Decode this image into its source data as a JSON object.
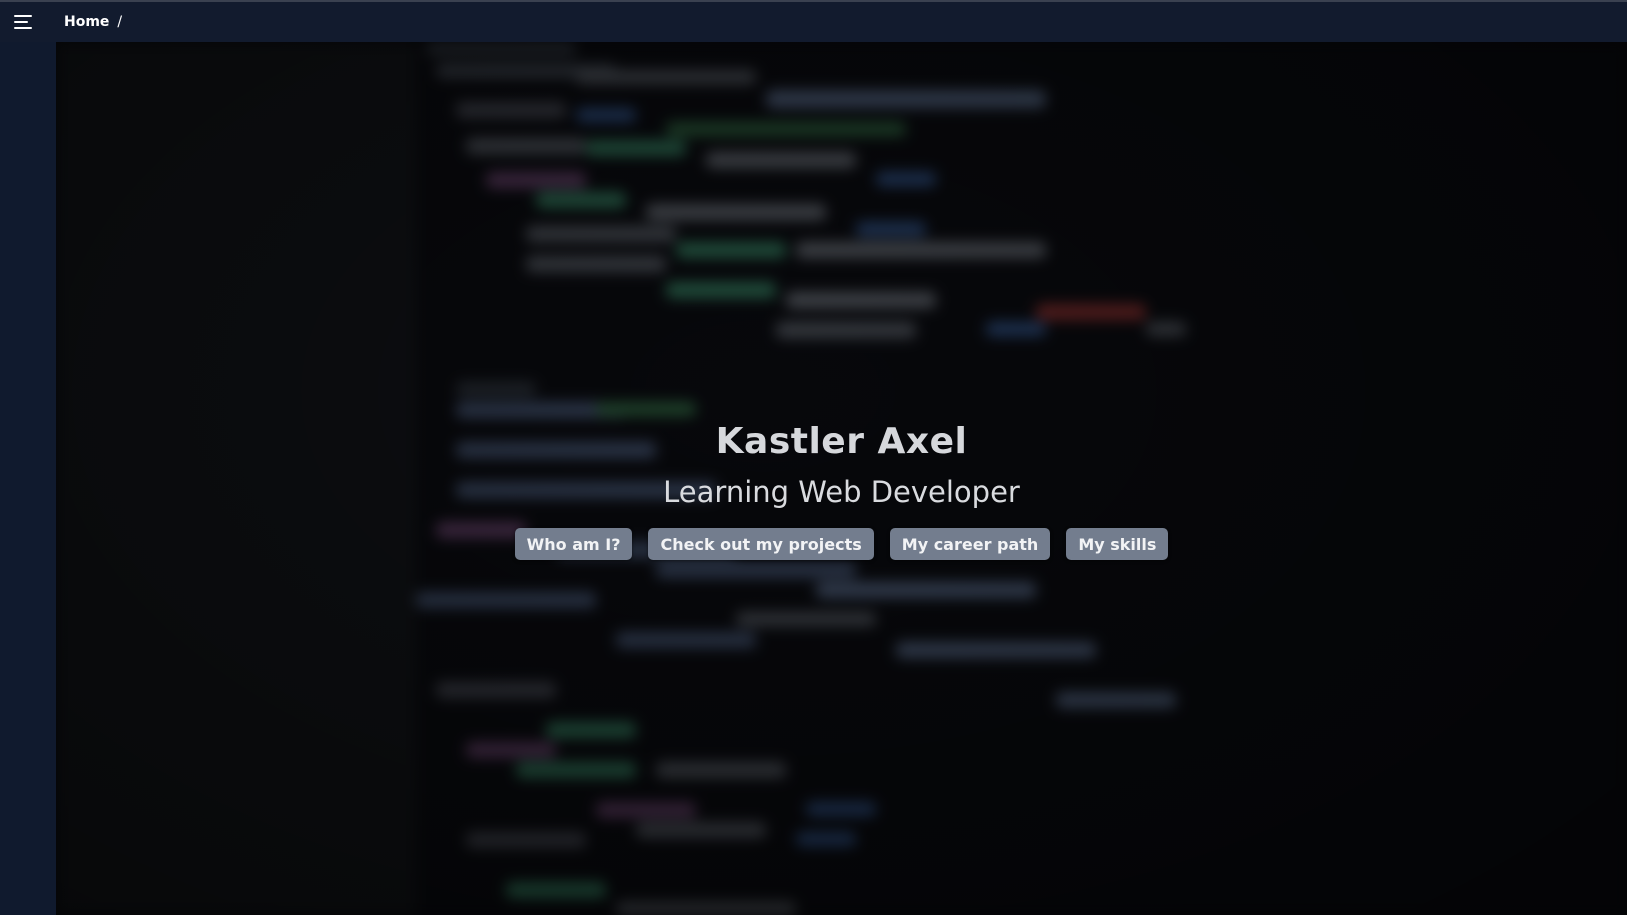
{
  "topbar": {
    "menu_icon": "hamburger-menu-icon",
    "breadcrumb": {
      "home": "Home",
      "separator": "/"
    }
  },
  "hero": {
    "title": "Kastler Axel",
    "subtitle": "Learning Web Developer",
    "buttons": [
      {
        "label": "Who am I?"
      },
      {
        "label": "Check out my projects"
      },
      {
        "label": "My career path"
      },
      {
        "label": "My skills"
      }
    ],
    "background": "blurred-code-editor-image"
  },
  "colors": {
    "topbar": "#121b2e",
    "sidebar": "#101a2e",
    "button": "#737d8e",
    "text": "#d6d8dc"
  }
}
